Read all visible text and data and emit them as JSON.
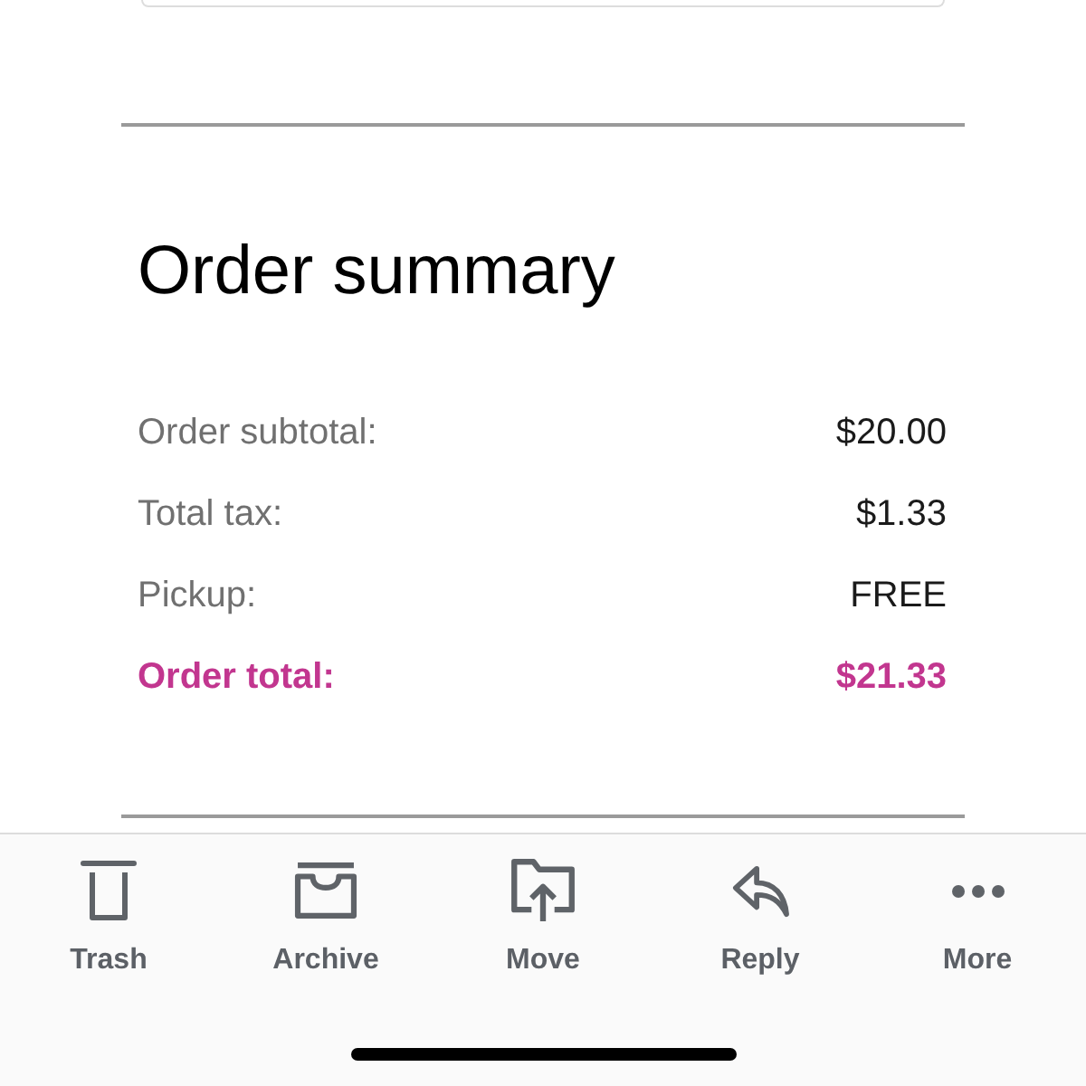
{
  "summary": {
    "title": "Order summary",
    "rows": [
      {
        "kind": "line",
        "label": "Order subtotal:",
        "value": "$20.00"
      },
      {
        "kind": "line",
        "label": "Total tax:",
        "value": "$1.33"
      },
      {
        "kind": "line",
        "label": "Pickup:",
        "value": "FREE"
      },
      {
        "kind": "total",
        "label": "Order total:",
        "value": "$21.33"
      }
    ]
  },
  "toolbar": {
    "items": [
      {
        "label": "Trash"
      },
      {
        "label": "Archive"
      },
      {
        "label": "Move"
      },
      {
        "label": "Reply"
      },
      {
        "label": "More"
      }
    ]
  }
}
